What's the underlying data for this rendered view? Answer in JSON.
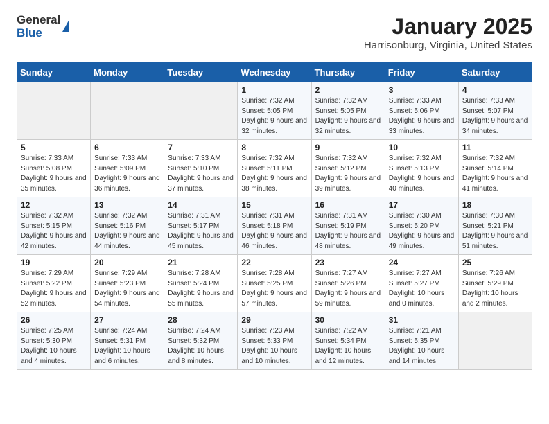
{
  "header": {
    "logo": {
      "general": "General",
      "blue": "Blue"
    },
    "title": "January 2025",
    "location": "Harrisonburg, Virginia, United States"
  },
  "weekdays": [
    "Sunday",
    "Monday",
    "Tuesday",
    "Wednesday",
    "Thursday",
    "Friday",
    "Saturday"
  ],
  "weeks": [
    [
      {
        "day": "",
        "info": ""
      },
      {
        "day": "",
        "info": ""
      },
      {
        "day": "",
        "info": ""
      },
      {
        "day": "1",
        "info": "Sunrise: 7:32 AM\nSunset: 5:05 PM\nDaylight: 9 hours and 32 minutes."
      },
      {
        "day": "2",
        "info": "Sunrise: 7:32 AM\nSunset: 5:05 PM\nDaylight: 9 hours and 32 minutes."
      },
      {
        "day": "3",
        "info": "Sunrise: 7:33 AM\nSunset: 5:06 PM\nDaylight: 9 hours and 33 minutes."
      },
      {
        "day": "4",
        "info": "Sunrise: 7:33 AM\nSunset: 5:07 PM\nDaylight: 9 hours and 34 minutes."
      }
    ],
    [
      {
        "day": "5",
        "info": "Sunrise: 7:33 AM\nSunset: 5:08 PM\nDaylight: 9 hours and 35 minutes."
      },
      {
        "day": "6",
        "info": "Sunrise: 7:33 AM\nSunset: 5:09 PM\nDaylight: 9 hours and 36 minutes."
      },
      {
        "day": "7",
        "info": "Sunrise: 7:33 AM\nSunset: 5:10 PM\nDaylight: 9 hours and 37 minutes."
      },
      {
        "day": "8",
        "info": "Sunrise: 7:32 AM\nSunset: 5:11 PM\nDaylight: 9 hours and 38 minutes."
      },
      {
        "day": "9",
        "info": "Sunrise: 7:32 AM\nSunset: 5:12 PM\nDaylight: 9 hours and 39 minutes."
      },
      {
        "day": "10",
        "info": "Sunrise: 7:32 AM\nSunset: 5:13 PM\nDaylight: 9 hours and 40 minutes."
      },
      {
        "day": "11",
        "info": "Sunrise: 7:32 AM\nSunset: 5:14 PM\nDaylight: 9 hours and 41 minutes."
      }
    ],
    [
      {
        "day": "12",
        "info": "Sunrise: 7:32 AM\nSunset: 5:15 PM\nDaylight: 9 hours and 42 minutes."
      },
      {
        "day": "13",
        "info": "Sunrise: 7:32 AM\nSunset: 5:16 PM\nDaylight: 9 hours and 44 minutes."
      },
      {
        "day": "14",
        "info": "Sunrise: 7:31 AM\nSunset: 5:17 PM\nDaylight: 9 hours and 45 minutes."
      },
      {
        "day": "15",
        "info": "Sunrise: 7:31 AM\nSunset: 5:18 PM\nDaylight: 9 hours and 46 minutes."
      },
      {
        "day": "16",
        "info": "Sunrise: 7:31 AM\nSunset: 5:19 PM\nDaylight: 9 hours and 48 minutes."
      },
      {
        "day": "17",
        "info": "Sunrise: 7:30 AM\nSunset: 5:20 PM\nDaylight: 9 hours and 49 minutes."
      },
      {
        "day": "18",
        "info": "Sunrise: 7:30 AM\nSunset: 5:21 PM\nDaylight: 9 hours and 51 minutes."
      }
    ],
    [
      {
        "day": "19",
        "info": "Sunrise: 7:29 AM\nSunset: 5:22 PM\nDaylight: 9 hours and 52 minutes."
      },
      {
        "day": "20",
        "info": "Sunrise: 7:29 AM\nSunset: 5:23 PM\nDaylight: 9 hours and 54 minutes."
      },
      {
        "day": "21",
        "info": "Sunrise: 7:28 AM\nSunset: 5:24 PM\nDaylight: 9 hours and 55 minutes."
      },
      {
        "day": "22",
        "info": "Sunrise: 7:28 AM\nSunset: 5:25 PM\nDaylight: 9 hours and 57 minutes."
      },
      {
        "day": "23",
        "info": "Sunrise: 7:27 AM\nSunset: 5:26 PM\nDaylight: 9 hours and 59 minutes."
      },
      {
        "day": "24",
        "info": "Sunrise: 7:27 AM\nSunset: 5:27 PM\nDaylight: 10 hours and 0 minutes."
      },
      {
        "day": "25",
        "info": "Sunrise: 7:26 AM\nSunset: 5:29 PM\nDaylight: 10 hours and 2 minutes."
      }
    ],
    [
      {
        "day": "26",
        "info": "Sunrise: 7:25 AM\nSunset: 5:30 PM\nDaylight: 10 hours and 4 minutes."
      },
      {
        "day": "27",
        "info": "Sunrise: 7:24 AM\nSunset: 5:31 PM\nDaylight: 10 hours and 6 minutes."
      },
      {
        "day": "28",
        "info": "Sunrise: 7:24 AM\nSunset: 5:32 PM\nDaylight: 10 hours and 8 minutes."
      },
      {
        "day": "29",
        "info": "Sunrise: 7:23 AM\nSunset: 5:33 PM\nDaylight: 10 hours and 10 minutes."
      },
      {
        "day": "30",
        "info": "Sunrise: 7:22 AM\nSunset: 5:34 PM\nDaylight: 10 hours and 12 minutes."
      },
      {
        "day": "31",
        "info": "Sunrise: 7:21 AM\nSunset: 5:35 PM\nDaylight: 10 hours and 14 minutes."
      },
      {
        "day": "",
        "info": ""
      }
    ]
  ]
}
